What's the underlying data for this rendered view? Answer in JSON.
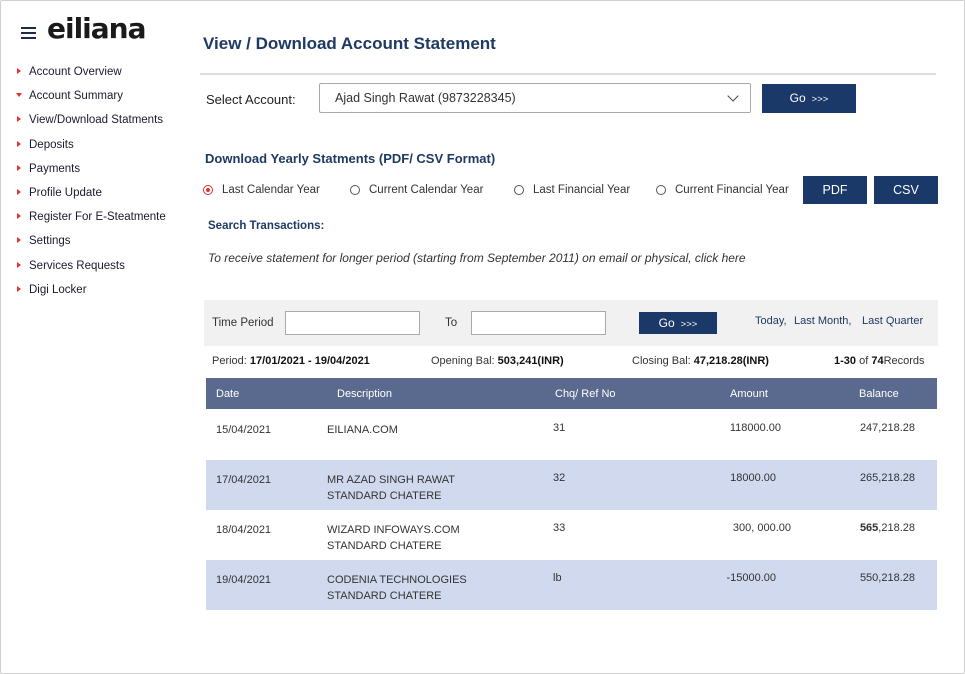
{
  "logo": {
    "text": "eiliana"
  },
  "sidebar": {
    "items": [
      {
        "label": "Account Overview",
        "marker": "right"
      },
      {
        "label": "Account Summary",
        "marker": "down"
      },
      {
        "label": "View/Download Statments",
        "marker": "right"
      },
      {
        "label": "Deposits",
        "marker": "right"
      },
      {
        "label": "Payments",
        "marker": "right"
      },
      {
        "label": "Profile Update",
        "marker": "right"
      },
      {
        "label": "Register For E-Steatmente",
        "marker": "right"
      },
      {
        "label": "Settings",
        "marker": "right"
      },
      {
        "label": "Services Requests",
        "marker": "right"
      },
      {
        "label": "Digi Locker",
        "marker": "right"
      }
    ]
  },
  "page": {
    "title": "View / Download Account Statement"
  },
  "account": {
    "label": "Select Account:",
    "selected": "Ajad Singh Rawat (9873228345)",
    "go_label": "Go",
    "go_arrows": ">>>"
  },
  "yearly": {
    "title": "Download Yearly Statments (PDF/ CSV Format)",
    "options": [
      {
        "label": "Last Calendar Year",
        "selected": true
      },
      {
        "label": "Current Calendar Year",
        "selected": false
      },
      {
        "label": "Last Financial Year",
        "selected": false
      },
      {
        "label": "Current Financial Year",
        "selected": false
      }
    ],
    "pdf_label": "PDF",
    "csv_label": "CSV"
  },
  "search": {
    "title": "Search Transactions:",
    "notice": "To receive statement for longer period (starting from September 2011) on email or physical, click here",
    "time_period_label": "Time Period",
    "from_value": "",
    "to_label": "To",
    "to_value": "",
    "go_label": "Go",
    "go_arrows": ">>>",
    "quick_links": [
      "Today,",
      "Last Month,",
      "Last Quarter"
    ]
  },
  "summary": {
    "period_label": "Period:",
    "period_value": "17/01/2021 - 19/04/2021",
    "opening_label": "Opening Bal:",
    "opening_value": "503,241(INR)",
    "closing_label": "Closing Bal:",
    "closing_value": "47,218.28(INR)",
    "records_range": "1-30",
    "records_of": "of",
    "records_total": "74",
    "records_suffix": "Records"
  },
  "table": {
    "headers": [
      "Date",
      "Description",
      "Chq/ Ref No",
      "Amount",
      "Balance"
    ],
    "rows": [
      {
        "date": "15/04/2021",
        "desc1": "EILIANA.COM",
        "desc2": "",
        "ref": "31",
        "amount": "118000.00",
        "balance": "247,218.28",
        "balance_bold": ""
      },
      {
        "date": "17/04/2021",
        "desc1": "MR AZAD SINGH RAWAT",
        "desc2": "STANDARD CHATERE",
        "ref": "32",
        "amount": "18000.00",
        "balance": "265,218.28",
        "balance_bold": ""
      },
      {
        "date": "18/04/2021",
        "desc1": "WIZARD INFOWAYS.COM",
        "desc2": "STANDARD CHATERE",
        "ref": "33",
        "amount": "300, 000.00",
        "balance": ",218.28",
        "balance_bold": "565"
      },
      {
        "date": "19/04/2021",
        "desc1": "CODENIA TECHNOLOGIES",
        "desc2": "STANDARD CHATERE",
        "ref": "lb",
        "amount": "-15000.00",
        "balance": "550,218.28",
        "balance_bold": ""
      }
    ]
  },
  "colors": {
    "brand_navy": "#1b3968",
    "accent_red": "#e0332c",
    "table_header": "#5a6a8e",
    "row_highlight": "#d0d9ed"
  }
}
